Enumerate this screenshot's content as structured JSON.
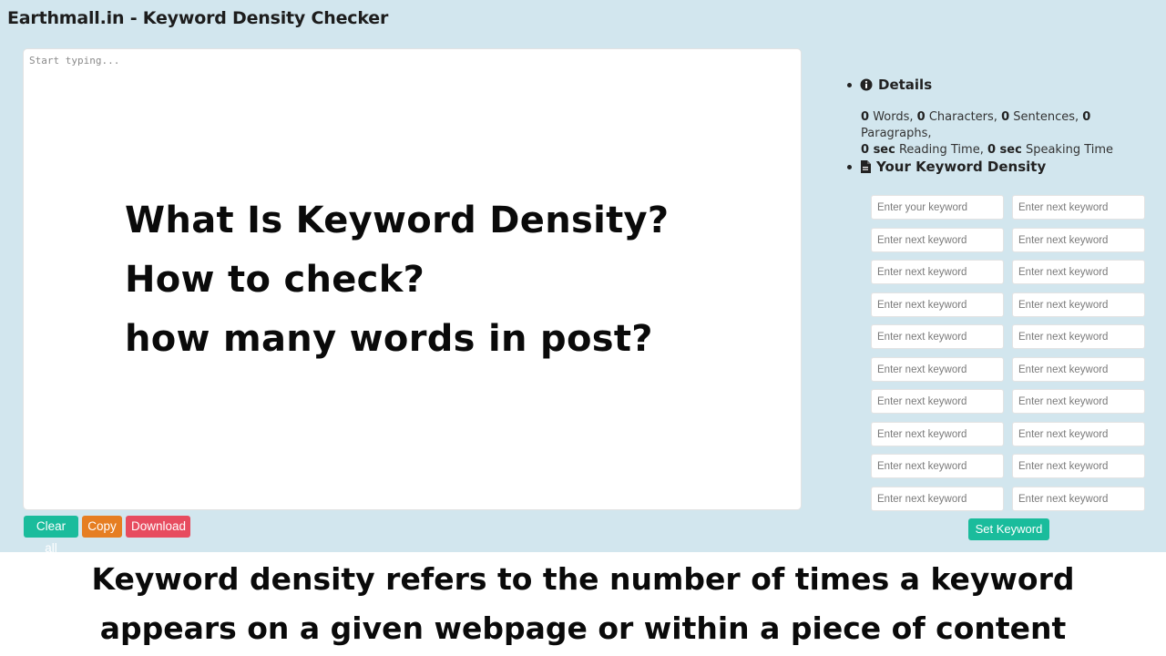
{
  "app": {
    "title": "Earthmall.in - Keyword Density Checker"
  },
  "editor": {
    "placeholder": "Start typing...",
    "value": ""
  },
  "overlay": {
    "lines": [
      "What Is Keyword Density?",
      "How to check?",
      "how many words in post?"
    ]
  },
  "toolbar": {
    "clear_label": "Clear all",
    "copy_label": "Copy",
    "download_label": "Download"
  },
  "details": {
    "heading": "Details",
    "icon": "info-circle-icon",
    "words": "0",
    "words_label": "Words,",
    "characters": "0",
    "characters_label": "Characters,",
    "sentences": "0",
    "sentences_label": "Sentences,",
    "paragraphs": "0",
    "paragraphs_label": "Paragraphs,",
    "reading_time": "0 sec",
    "reading_label": "Reading Time,",
    "speaking_time": "0 sec",
    "speaking_label": "Speaking Time"
  },
  "density": {
    "heading": "Your Keyword Density",
    "icon": "document-icon",
    "first_placeholder": "Enter your keyword",
    "next_placeholder": "Enter next keyword",
    "set_label": "Set Keyword"
  },
  "caption": {
    "lines": [
      "Keyword density refers to the number of times a keyword",
      "appears on a given webpage or within a piece of content"
    ]
  },
  "colors": {
    "app_background": "#d2e6ee",
    "teal": "#1abc9c",
    "orange": "#e67e22",
    "red": "#e74c5f"
  }
}
